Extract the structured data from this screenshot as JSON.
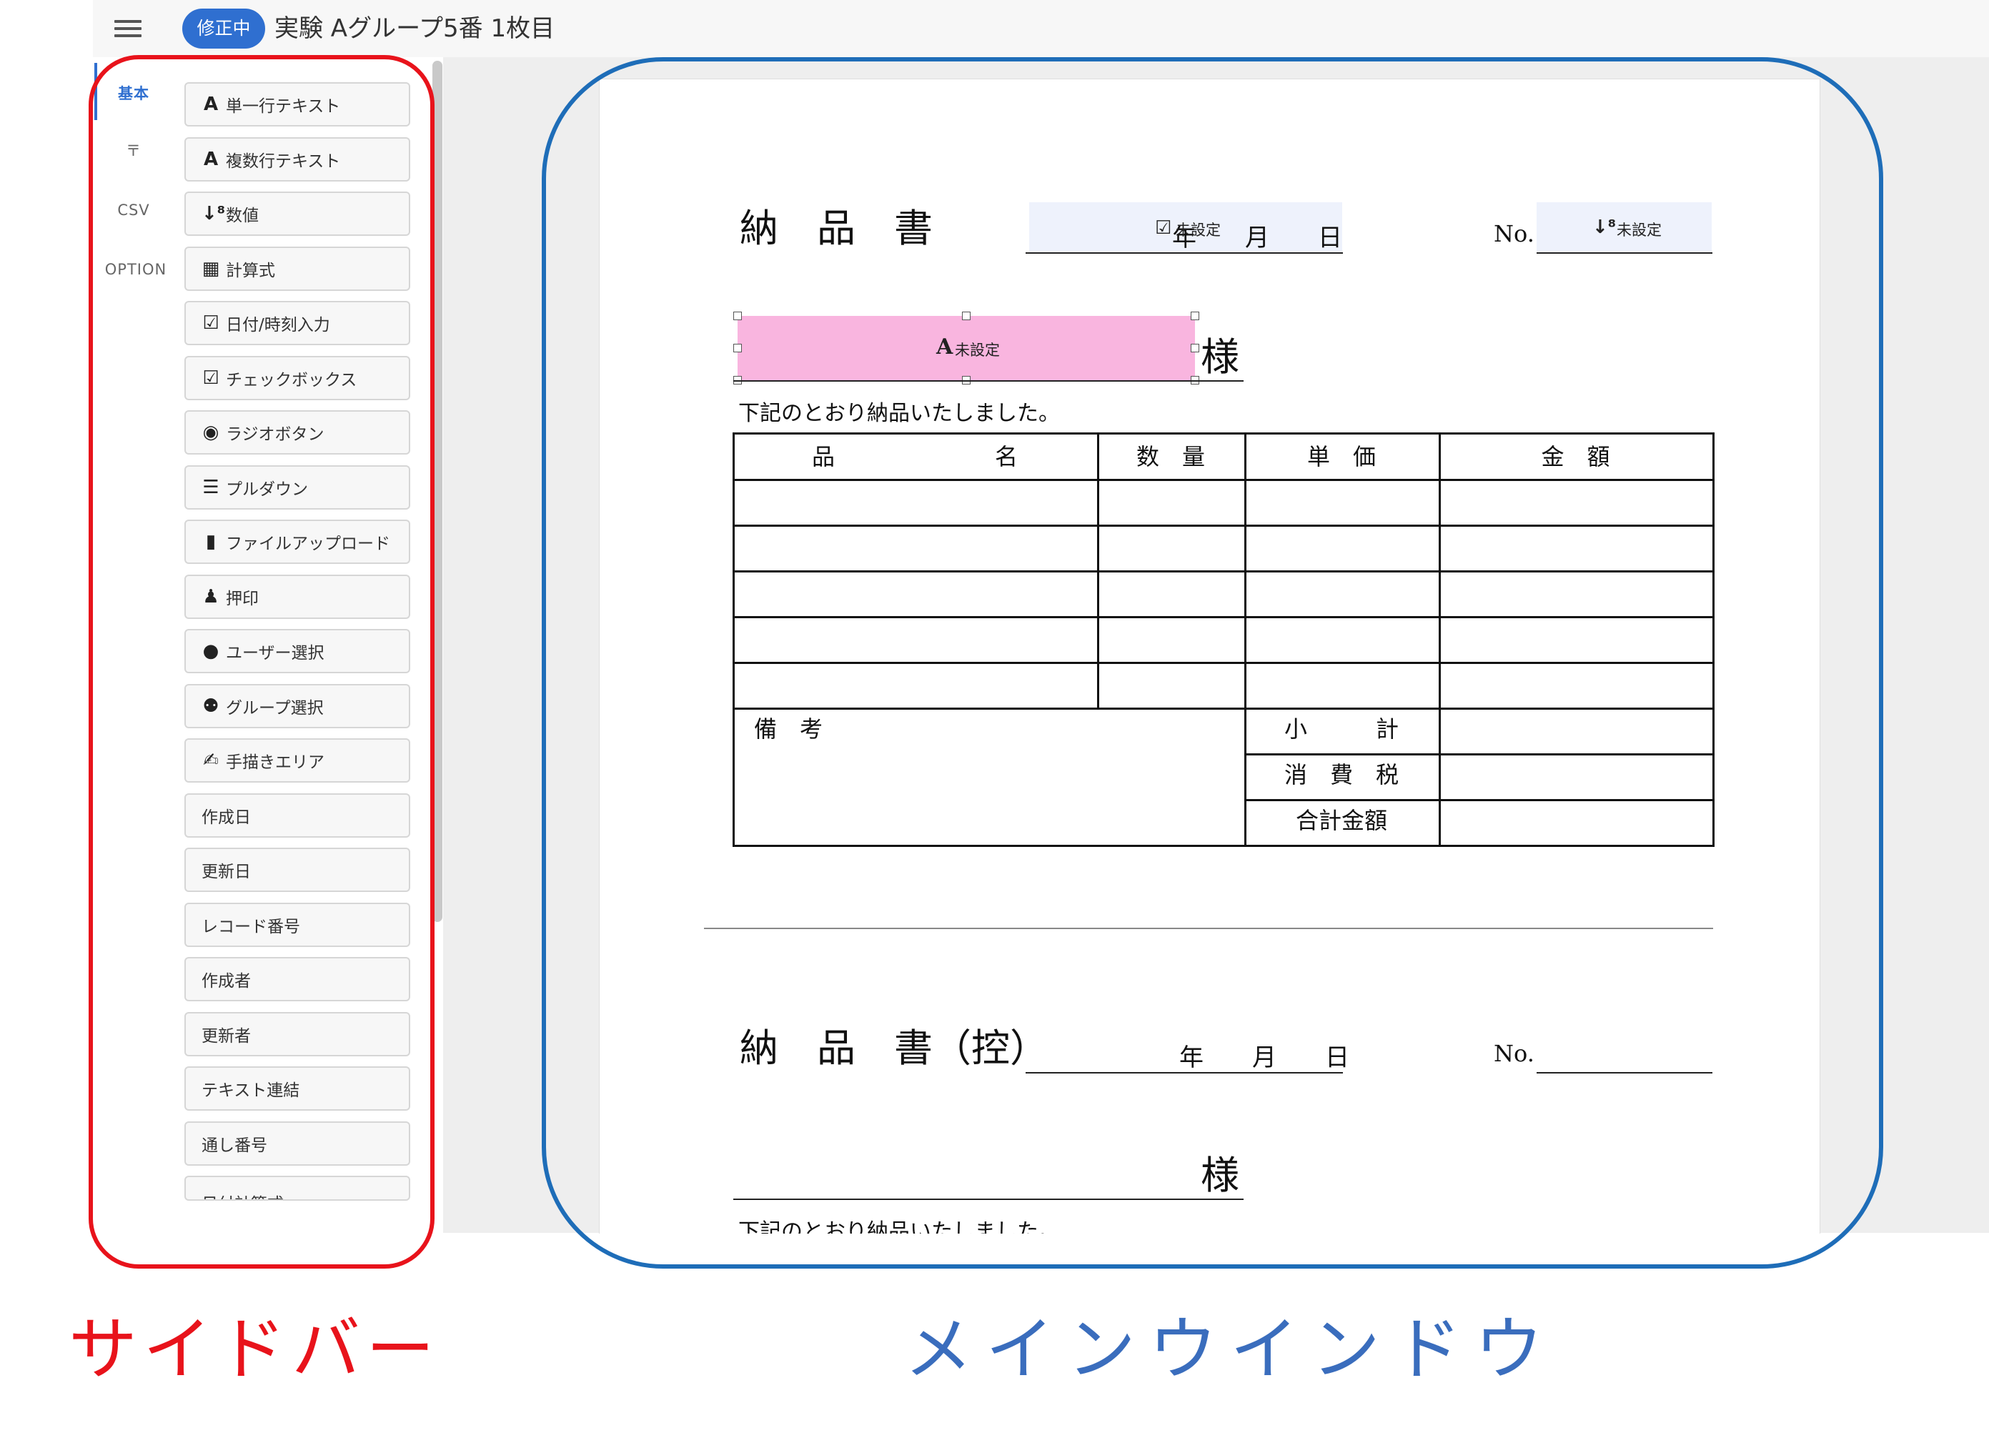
{
  "header": {
    "status_badge": "修正中",
    "title": "実験 Aグループ5番 1枚目"
  },
  "sidebar": {
    "tabs": [
      "基本",
      "〒",
      "CSV",
      "OPTION"
    ],
    "tools": [
      {
        "label": "単一行テキスト",
        "icon": "text-icon",
        "glyph": "A"
      },
      {
        "label": "複数行テキスト",
        "icon": "text-icon",
        "glyph": "A"
      },
      {
        "label": "数値",
        "icon": "number-sort-icon",
        "glyph": "↓⁸"
      },
      {
        "label": "計算式",
        "icon": "calculator-icon",
        "glyph": "▦"
      },
      {
        "label": "日付/時刻入力",
        "icon": "calendar-check-icon",
        "glyph": "☑"
      },
      {
        "label": "チェックボックス",
        "icon": "checkbox-icon",
        "glyph": "☑"
      },
      {
        "label": "ラジオボタン",
        "icon": "radio-icon",
        "glyph": "◉"
      },
      {
        "label": "プルダウン",
        "icon": "list-icon",
        "glyph": "☰"
      },
      {
        "label": "ファイルアップロード",
        "icon": "file-upload-icon",
        "glyph": "▮"
      },
      {
        "label": "押印",
        "icon": "stamp-icon",
        "glyph": "♟"
      },
      {
        "label": "ユーザー選択",
        "icon": "user-icon",
        "glyph": "●"
      },
      {
        "label": "グループ選択",
        "icon": "group-icon",
        "glyph": "⚉"
      },
      {
        "label": "手描きエリア",
        "icon": "signature-icon",
        "glyph": "✍"
      },
      {
        "label": "作成日",
        "icon": "",
        "glyph": ""
      },
      {
        "label": "更新日",
        "icon": "",
        "glyph": ""
      },
      {
        "label": "レコード番号",
        "icon": "",
        "glyph": ""
      },
      {
        "label": "作成者",
        "icon": "",
        "glyph": ""
      },
      {
        "label": "更新者",
        "icon": "",
        "glyph": ""
      },
      {
        "label": "テキスト連結",
        "icon": "",
        "glyph": ""
      },
      {
        "label": "通し番号",
        "icon": "",
        "glyph": ""
      },
      {
        "label": "日付計算式",
        "icon": "",
        "glyph": ""
      }
    ]
  },
  "form": {
    "title": "納　品　書",
    "copy_title": "納　品　書（控）",
    "date_label": "年　　月　　日",
    "no_label": "No.",
    "unset": "未設定",
    "sama": "様",
    "message": "下記のとおり納品いたしました。",
    "headers": [
      "品　　　　　　　名",
      "数　量",
      "単　価",
      "金　額"
    ],
    "remarks": "備　考",
    "subtotal": "小　　　計",
    "tax": "消　費　税",
    "total": "合計金額"
  },
  "annotations": {
    "sidebar": "サイドバー",
    "main": "メインウインドウ"
  },
  "colors": {
    "badge": "#2f6fd0",
    "selected_field": "#f9b5df",
    "field_bg": "#eef2fc",
    "sidebar_outline": "#e8131b",
    "main_outline": "#1e6db8"
  }
}
